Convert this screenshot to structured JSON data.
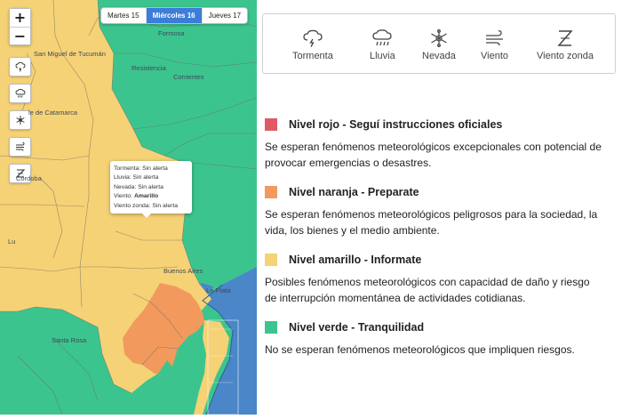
{
  "map": {
    "zoom_in": "+",
    "zoom_out": "−",
    "day_tabs": [
      {
        "label": "Martes 15",
        "active": false
      },
      {
        "label": "Miércoles 16",
        "active": true
      },
      {
        "label": "Jueves 17",
        "active": false
      }
    ],
    "filter_icons": [
      "storm-icon",
      "rain-icon",
      "snow-icon",
      "wind-icon",
      "zonda-wind-icon"
    ],
    "places": [
      "Formosa",
      "San Miguel de Tucumán",
      "Resistencia",
      "Corrientes",
      "le de Catamarca",
      "Córdoba",
      "Lu",
      "Buenos Aires",
      "La Plata",
      "Santa Rosa"
    ],
    "tooltip": {
      "tormenta": "Tormenta: Sin alerta",
      "lluvia": "Lluvia: Sin alerta",
      "nevada": "Nevada: Sin alerta",
      "viento_prefix": "Viento: ",
      "viento_value": "Amarillo",
      "viento_zonda": "Viento zonda: Sin alerta"
    },
    "colors": {
      "green": "#3cc48e",
      "yellow": "#f6d276",
      "orange": "#f29a5d",
      "water": "#4a86c8",
      "border": "#555555"
    }
  },
  "hazards": [
    {
      "label": "Tormenta",
      "icon": "storm-icon"
    },
    {
      "label": "Lluvia",
      "icon": "rain-icon"
    },
    {
      "label": "Nevada",
      "icon": "snow-icon"
    },
    {
      "label": "Viento",
      "icon": "wind-icon"
    },
    {
      "label": "Viento zonda",
      "icon": "zonda-wind-icon"
    }
  ],
  "levels": [
    {
      "color": "#e05a66",
      "title": "Nivel rojo - Seguí instrucciones oficiales",
      "description": "Se esperan fenómenos meteorológicos excepcionales con potencial de provocar emergencias o desastres."
    },
    {
      "color": "#f29a5d",
      "title": "Nivel naranja - Preparate",
      "description": "Se esperan fenómenos meteorológicos peligrosos para la sociedad, la vida, los bienes y el medio ambiente."
    },
    {
      "color": "#f6d276",
      "title": "Nivel amarillo - Informate",
      "description": "Posibles fenómenos meteorológicos con capacidad de daño y riesgo de interrupción momentánea de actividades cotidianas."
    },
    {
      "color": "#3cc48e",
      "title": "Nivel verde - Tranquilidad",
      "description": "No se esperan fenómenos meteorológicos que impliquen riesgos."
    }
  ]
}
